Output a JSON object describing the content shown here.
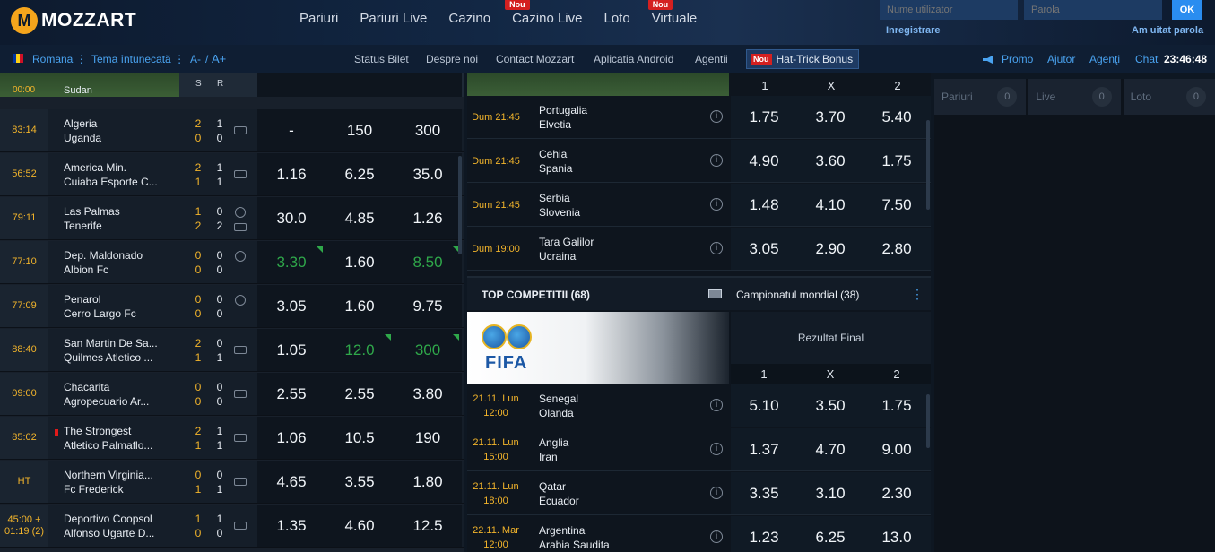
{
  "header": {
    "logo_mark": "M",
    "logo_text": "MOZZART",
    "nav": [
      {
        "label": "Pariuri",
        "badge": ""
      },
      {
        "label": "Pariuri Live",
        "badge": ""
      },
      {
        "label": "Cazino",
        "badge": ""
      },
      {
        "label": "Cazino Live",
        "badge": "Nou"
      },
      {
        "label": "Loto",
        "badge": ""
      },
      {
        "label": "Virtuale",
        "badge": "Nou"
      }
    ],
    "username_placeholder": "Nume utilizator",
    "password_placeholder": "Parola",
    "ok_label": "OK",
    "register_label": "Inregistrare",
    "forgot_label": "Am uitat parola"
  },
  "subnav": {
    "language": "Romana",
    "theme": "Tema întunecată",
    "font_minus": "A-",
    "separator": "/",
    "font_plus": "A+",
    "links": [
      "Status Bilet",
      "Despre noi",
      "Contact Mozzart",
      "Aplicatia Android",
      "Agentii"
    ],
    "hattrick_badge": "Nou",
    "hattrick_label": "Hat-Trick Bonus",
    "promo": "Promo",
    "help": "Ajutor",
    "agents": "Agenţi",
    "chat": "Chat",
    "clock": "23:46:48",
    "colors": {
      "accent": "#f2b42b",
      "link": "#4aa3f0",
      "badge": "#d42020"
    }
  },
  "live": {
    "header_s": "S",
    "header_r": "R",
    "partial_row": {
      "time": "00:00",
      "team": "Sudan"
    },
    "rows": [
      {
        "time": "83:14",
        "home": "Algeria",
        "away": "Uganda",
        "s_home": "2",
        "s_away": "0",
        "r_home": "1",
        "r_away": "0",
        "icon": "stadium-icon",
        "odds": [
          "-",
          "150",
          "300"
        ],
        "green": [
          false,
          false,
          false
        ],
        "red_card": false
      },
      {
        "time": "56:52",
        "home": "America Min.",
        "away": "Cuiaba Esporte C...",
        "s_home": "2",
        "s_away": "1",
        "r_home": "1",
        "r_away": "1",
        "icon": "stadium-icon",
        "odds": [
          "1.16",
          "6.25",
          "35.0"
        ],
        "green": [
          false,
          false,
          false
        ],
        "red_card": false
      },
      {
        "time": "79:11",
        "home": "Las Palmas",
        "away": "Tenerife",
        "s_home": "1",
        "s_away": "2",
        "r_home": "0",
        "r_away": "2",
        "icon": "play-icon",
        "odds": [
          "30.0",
          "4.85",
          "1.26"
        ],
        "green": [
          false,
          false,
          false
        ],
        "red_card": false
      },
      {
        "time": "77:10",
        "home": "Dep. Maldonado",
        "away": "Albion Fc",
        "s_home": "0",
        "s_away": "0",
        "r_home": "0",
        "r_away": "0",
        "icon": "play-icon",
        "odds": [
          "3.30",
          "1.60",
          "8.50"
        ],
        "green": [
          true,
          false,
          true
        ],
        "red_card": false
      },
      {
        "time": "77:09",
        "home": "Penarol",
        "away": "Cerro Largo Fc",
        "s_home": "0",
        "s_away": "0",
        "r_home": "0",
        "r_away": "0",
        "icon": "play-icon",
        "odds": [
          "3.05",
          "1.60",
          "9.75"
        ],
        "green": [
          false,
          false,
          false
        ],
        "red_card": false
      },
      {
        "time": "88:40",
        "home": "San Martin De Sa...",
        "away": "Quilmes Atletico ...",
        "s_home": "2",
        "s_away": "1",
        "r_home": "0",
        "r_away": "1",
        "icon": "stadium-icon",
        "odds": [
          "1.05",
          "12.0",
          "300"
        ],
        "green": [
          false,
          true,
          true
        ],
        "red_card": false
      },
      {
        "time": "09:00",
        "home": "Chacarita",
        "away": "Agropecuario Ar...",
        "s_home": "0",
        "s_away": "0",
        "r_home": "0",
        "r_away": "0",
        "icon": "stadium-icon",
        "odds": [
          "2.55",
          "2.55",
          "3.80"
        ],
        "green": [
          false,
          false,
          false
        ],
        "red_card": false
      },
      {
        "time": "85:02",
        "home": "The Strongest",
        "away": "Atletico Palmaflo...",
        "s_home": "2",
        "s_away": "1",
        "r_home": "1",
        "r_away": "1",
        "icon": "stadium-icon",
        "odds": [
          "1.06",
          "10.5",
          "190"
        ],
        "green": [
          false,
          false,
          false
        ],
        "red_card": true
      },
      {
        "time": "HT",
        "home": "Northern Virginia...",
        "away": "Fc Frederick",
        "s_home": "0",
        "s_away": "1",
        "r_home": "0",
        "r_away": "1",
        "icon": "stadium-icon",
        "odds": [
          "4.65",
          "3.55",
          "1.80"
        ],
        "green": [
          false,
          false,
          false
        ],
        "red_card": false
      },
      {
        "time": "45:00 + 01:19 (2)",
        "home": "Deportivo Coopsol",
        "away": "Alfonso Ugarte D...",
        "s_home": "1",
        "s_away": "0",
        "r_home": "1",
        "r_away": "0",
        "icon": "stadium-icon",
        "odds": [
          "1.35",
          "4.60",
          "12.5"
        ],
        "green": [
          false,
          false,
          false
        ],
        "red_card": false
      }
    ]
  },
  "upcoming": {
    "headers": [
      "1",
      "X",
      "2"
    ],
    "rows": [
      {
        "time": "Dum 21:45",
        "home": "Portugalia",
        "away": "Elvetia",
        "odds": [
          "1.75",
          "3.70",
          "5.40"
        ]
      },
      {
        "time": "Dum 21:45",
        "home": "Cehia",
        "away": "Spania",
        "odds": [
          "4.90",
          "3.60",
          "1.75"
        ]
      },
      {
        "time": "Dum 21:45",
        "home": "Serbia",
        "away": "Slovenia",
        "odds": [
          "1.48",
          "4.10",
          "7.50"
        ]
      },
      {
        "time": "Dum 19:00",
        "home": "Tara Galilor",
        "away": "Ucraina",
        "odds": [
          "3.05",
          "2.90",
          "2.80"
        ]
      }
    ],
    "top_title": "TOP COMPETITII (68)",
    "competition": "Campionatul mondial (38)",
    "fifa_label": "FIFA",
    "market_label": "Rezultat Final",
    "wc_headers": [
      "1",
      "X",
      "2"
    ],
    "wc_rows": [
      {
        "time": "21.11. Lun 12:00",
        "home": "Senegal",
        "away": "Olanda",
        "odds": [
          "5.10",
          "3.50",
          "1.75"
        ]
      },
      {
        "time": "21.11. Lun 15:00",
        "home": "Anglia",
        "away": "Iran",
        "odds": [
          "1.37",
          "4.70",
          "9.00"
        ]
      },
      {
        "time": "21.11. Lun 18:00",
        "home": "Qatar",
        "away": "Ecuador",
        "odds": [
          "3.35",
          "3.10",
          "2.30"
        ]
      },
      {
        "time": "22.11. Mar 12:00",
        "home": "Argentina",
        "away": "Arabia Saudita",
        "odds": [
          "1.23",
          "6.25",
          "13.0"
        ]
      }
    ]
  },
  "ticket": {
    "tabs": [
      {
        "label": "Pariuri",
        "count": "0"
      },
      {
        "label": "Live",
        "count": "0"
      },
      {
        "label": "Loto",
        "count": "0"
      }
    ]
  }
}
